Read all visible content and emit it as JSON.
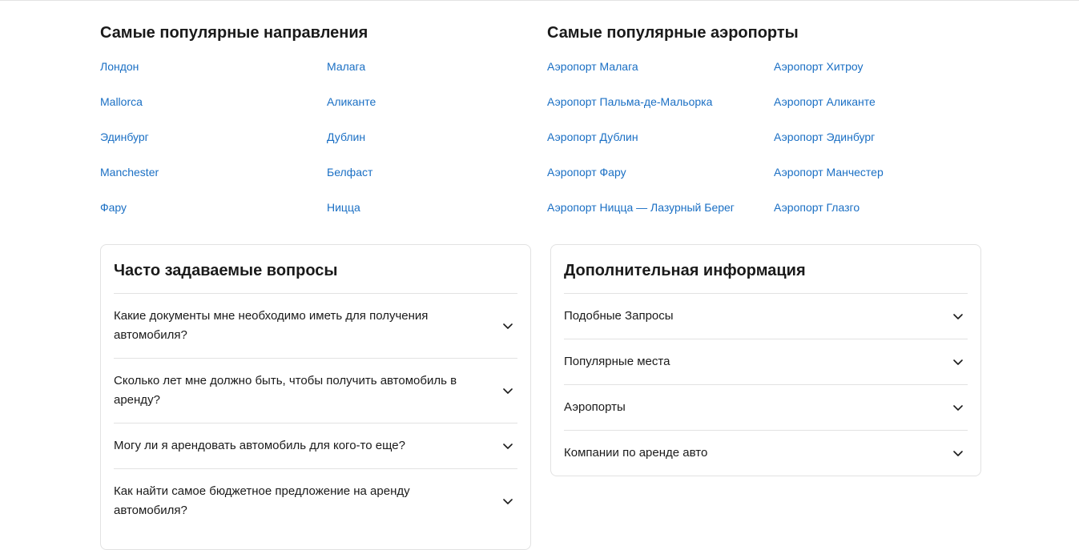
{
  "destinations": {
    "title": "Самые популярные направления",
    "links": [
      "Лондон",
      "Малага",
      "Mallorca",
      "Аликанте",
      "Эдинбург",
      "Дублин",
      "Manchester",
      "Белфаст",
      "Фару",
      "Ницца"
    ]
  },
  "airports": {
    "title": "Самые популярные аэропорты",
    "links": [
      "Аэропорт Малага",
      "Аэропорт Хитроу",
      "Аэропорт Пальма-де-Мальорка",
      "Аэропорт Аликанте",
      "Аэропорт Дублин",
      "Аэропорт Эдинбург",
      "Аэропорт Фару",
      "Аэропорт Манчестер",
      "Аэропорт Ницца — Лазурный Берег",
      "Аэропорт Глазго"
    ]
  },
  "faq": {
    "title": "Часто задаваемые вопросы",
    "items": [
      "Какие документы мне необходимо иметь для получения автомобиля?",
      "Сколько лет мне должно быть, чтобы получить автомобиль в аренду?",
      "Могу ли я арендовать автомобиль для кого-то еще?",
      "Как найти самое бюджетное предложение на аренду автомобиля?"
    ]
  },
  "info": {
    "title": "Дополнительная информация",
    "items": [
      "Подобные Запросы",
      "Популярные места",
      "Аэропорты",
      "Компании по аренде авто"
    ]
  },
  "icons": {
    "expand": "chevron-down-icon"
  },
  "colors": {
    "link": "#1a6fc4",
    "text": "#1a1a1a",
    "border": "#e2e2e2"
  }
}
